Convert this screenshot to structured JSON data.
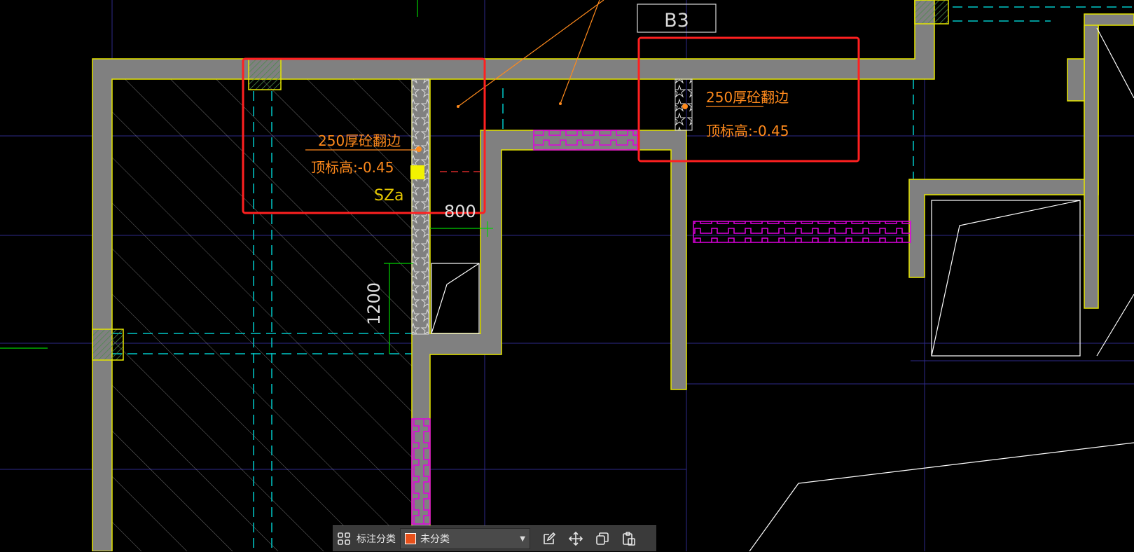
{
  "drawing": {
    "labels": {
      "room": "B3",
      "edge_note_left": "250厚砼翻边",
      "elev_note_left": "顶标高:-0.45",
      "edge_note_right": "250厚砼翻边",
      "elev_note_right": "顶标高:-0.45",
      "column_tag": "SZa",
      "dim_horizontal": "800",
      "dim_vertical": "1200"
    },
    "colors": {
      "background": "#000000",
      "wall_fill": "#808080",
      "wall_outline": "#e6e600",
      "axis_grid": "#2e2a8a",
      "dashed_beam": "#00c8c8",
      "annotation": "#ff8a1c",
      "highlight_box": "#ff2020",
      "hatch_magenta": "#e000e0",
      "dimension": "#00d000",
      "tag_yellow": "#e6c800"
    }
  },
  "toolbar": {
    "grid_icon": "grid-icon",
    "category_label": "标注分类",
    "category_value": "未分类",
    "category_swatch": "#e8501a",
    "buttons": [
      "edit-icon",
      "move-icon",
      "copy-icon",
      "paste-icon"
    ]
  }
}
